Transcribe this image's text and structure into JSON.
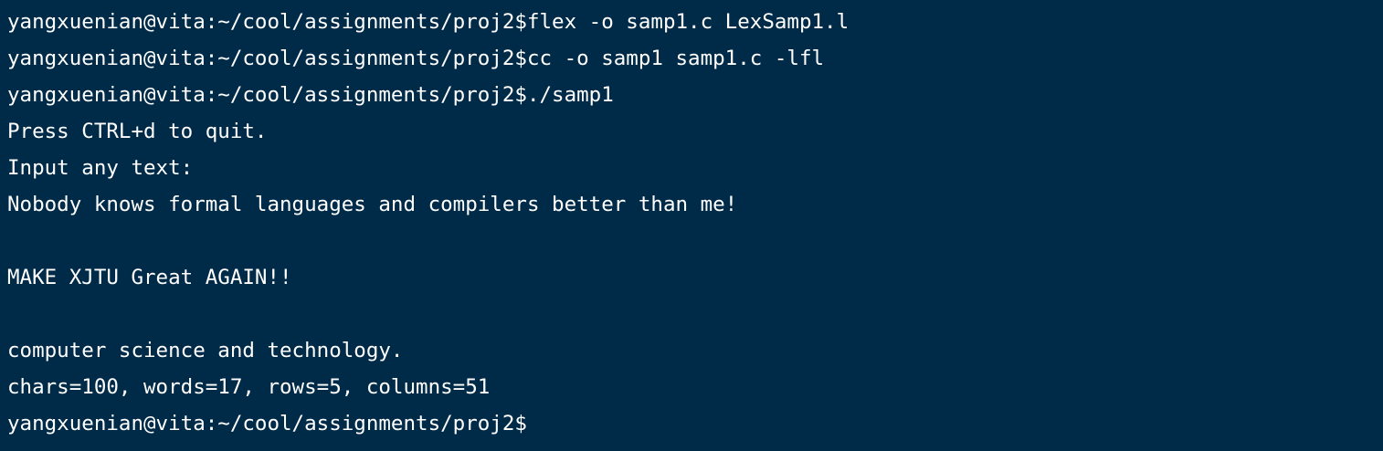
{
  "terminal": {
    "background_color": "#002b48",
    "text_color": "#ffffff",
    "lines": [
      "yangxuenian@vita:~/cool/assignments/proj2$flex -o samp1.c LexSamp1.l",
      "yangxuenian@vita:~/cool/assignments/proj2$cc -o samp1 samp1.c -lfl",
      "yangxuenian@vita:~/cool/assignments/proj2$./samp1",
      "Press CTRL+d to quit.",
      "Input any text:",
      "Nobody knows formal languages and compilers better than me!",
      "",
      "MAKE XJTU Great AGAIN!!",
      "",
      "computer science and technology.",
      "chars=100, words=17, rows=5, columns=51",
      "yangxuenian@vita:~/cool/assignments/proj2$"
    ]
  }
}
